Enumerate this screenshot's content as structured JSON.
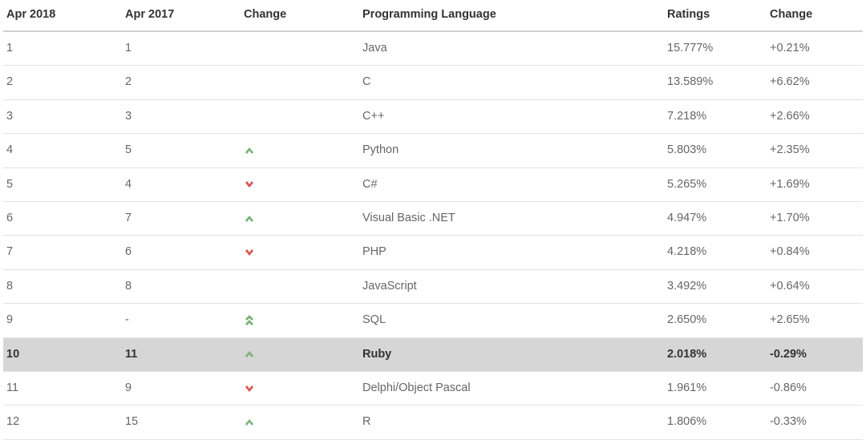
{
  "headers": {
    "c1": "Apr 2018",
    "c2": "Apr 2017",
    "c3": "Change",
    "c4": "Programming Language",
    "c5": "Ratings",
    "c6": "Change"
  },
  "rows": [
    {
      "pos_now": "1",
      "pos_prev": "1",
      "rank_change": "",
      "language": "Java",
      "ratings": "15.777%",
      "pct_change": "+0.21%",
      "highlight": false
    },
    {
      "pos_now": "2",
      "pos_prev": "2",
      "rank_change": "",
      "language": "C",
      "ratings": "13.589%",
      "pct_change": "+6.62%",
      "highlight": false
    },
    {
      "pos_now": "3",
      "pos_prev": "3",
      "rank_change": "",
      "language": "C++",
      "ratings": "7.218%",
      "pct_change": "+2.66%",
      "highlight": false
    },
    {
      "pos_now": "4",
      "pos_prev": "5",
      "rank_change": "up",
      "language": "Python",
      "ratings": "5.803%",
      "pct_change": "+2.35%",
      "highlight": false
    },
    {
      "pos_now": "5",
      "pos_prev": "4",
      "rank_change": "down",
      "language": "C#",
      "ratings": "5.265%",
      "pct_change": "+1.69%",
      "highlight": false
    },
    {
      "pos_now": "6",
      "pos_prev": "7",
      "rank_change": "up",
      "language": "Visual Basic .NET",
      "ratings": "4.947%",
      "pct_change": "+1.70%",
      "highlight": false
    },
    {
      "pos_now": "7",
      "pos_prev": "6",
      "rank_change": "down",
      "language": "PHP",
      "ratings": "4.218%",
      "pct_change": "+0.84%",
      "highlight": false
    },
    {
      "pos_now": "8",
      "pos_prev": "8",
      "rank_change": "",
      "language": "JavaScript",
      "ratings": "3.492%",
      "pct_change": "+0.64%",
      "highlight": false
    },
    {
      "pos_now": "9",
      "pos_prev": "-",
      "rank_change": "up2",
      "language": "SQL",
      "ratings": "2.650%",
      "pct_change": "+2.65%",
      "highlight": false
    },
    {
      "pos_now": "10",
      "pos_prev": "11",
      "rank_change": "up",
      "language": "Ruby",
      "ratings": "2.018%",
      "pct_change": "-0.29%",
      "highlight": true
    },
    {
      "pos_now": "11",
      "pos_prev": "9",
      "rank_change": "down",
      "language": "Delphi/Object Pascal",
      "ratings": "1.961%",
      "pct_change": "-0.86%",
      "highlight": false
    },
    {
      "pos_now": "12",
      "pos_prev": "15",
      "rank_change": "up",
      "language": "R",
      "ratings": "1.806%",
      "pct_change": "-0.33%",
      "highlight": false
    }
  ],
  "chart_data": {
    "type": "table",
    "title": "TIOBE Index – Programming Language Rankings, Apr 2018 vs Apr 2017",
    "columns": [
      "Apr 2018",
      "Apr 2017",
      "Rank Change",
      "Programming Language",
      "Ratings",
      "Change"
    ],
    "rows": [
      [
        1,
        1,
        "same",
        "Java",
        15.777,
        0.21
      ],
      [
        2,
        2,
        "same",
        "C",
        13.589,
        6.62
      ],
      [
        3,
        3,
        "same",
        "C++",
        7.218,
        2.66
      ],
      [
        4,
        5,
        "up",
        "Python",
        5.803,
        2.35
      ],
      [
        5,
        4,
        "down",
        "C#",
        5.265,
        1.69
      ],
      [
        6,
        7,
        "up",
        "Visual Basic .NET",
        4.947,
        1.7
      ],
      [
        7,
        6,
        "down",
        "PHP",
        4.218,
        0.84
      ],
      [
        8,
        8,
        "same",
        "JavaScript",
        3.492,
        0.64
      ],
      [
        9,
        null,
        "up-double",
        "SQL",
        2.65,
        2.65
      ],
      [
        10,
        11,
        "up",
        "Ruby",
        2.018,
        -0.29
      ],
      [
        11,
        9,
        "down",
        "Delphi/Object Pascal",
        1.961,
        -0.86
      ],
      [
        12,
        15,
        "up",
        "R",
        1.806,
        -0.33
      ]
    ]
  }
}
